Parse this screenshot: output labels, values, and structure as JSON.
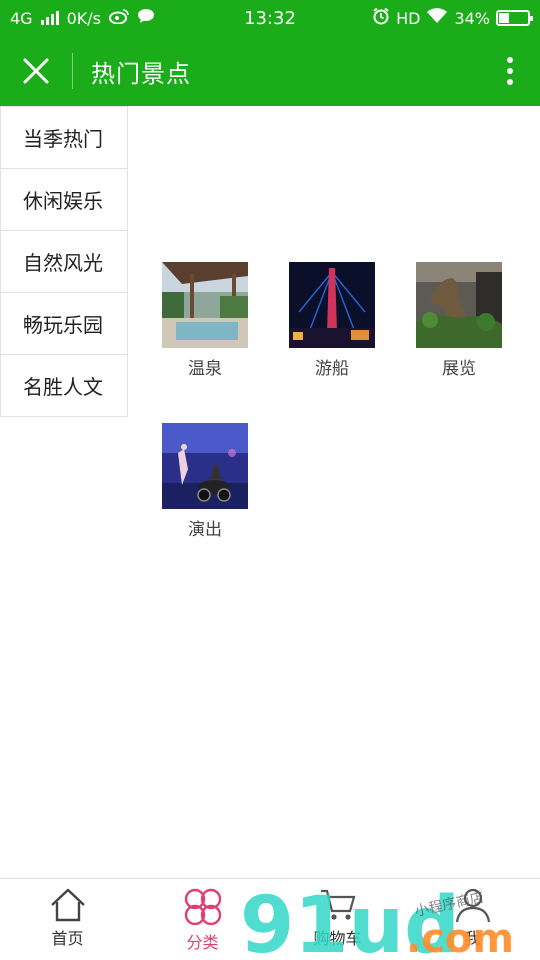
{
  "status_bar": {
    "network": "4G",
    "speed": "0K/s",
    "time": "13:32",
    "hd": "HD",
    "battery": "34%",
    "battery_level": 0.34
  },
  "header": {
    "title": "热门景点"
  },
  "sidebar": {
    "items": [
      {
        "label": "当季热门"
      },
      {
        "label": "休闲娱乐"
      },
      {
        "label": "自然风光"
      },
      {
        "label": "畅玩乐园"
      },
      {
        "label": "名胜人文"
      }
    ],
    "active_index": 1
  },
  "tiles": [
    {
      "label": "温泉"
    },
    {
      "label": "游船"
    },
    {
      "label": "展览"
    },
    {
      "label": "演出"
    }
  ],
  "tabbar": {
    "items": [
      {
        "label": "首页",
        "icon": "home-icon"
      },
      {
        "label": "分类",
        "icon": "category-icon"
      },
      {
        "label": "购物车",
        "icon": "cart-icon"
      },
      {
        "label": "我",
        "icon": "user-icon"
      }
    ],
    "active_index": 1
  },
  "watermark": {
    "brand": "91ud",
    "domain": ".com",
    "handwriting": "小程序商店"
  },
  "colors": {
    "brand_green": "#1aad19",
    "active_red": "#d9393d",
    "tab_active": "#e0406f"
  }
}
